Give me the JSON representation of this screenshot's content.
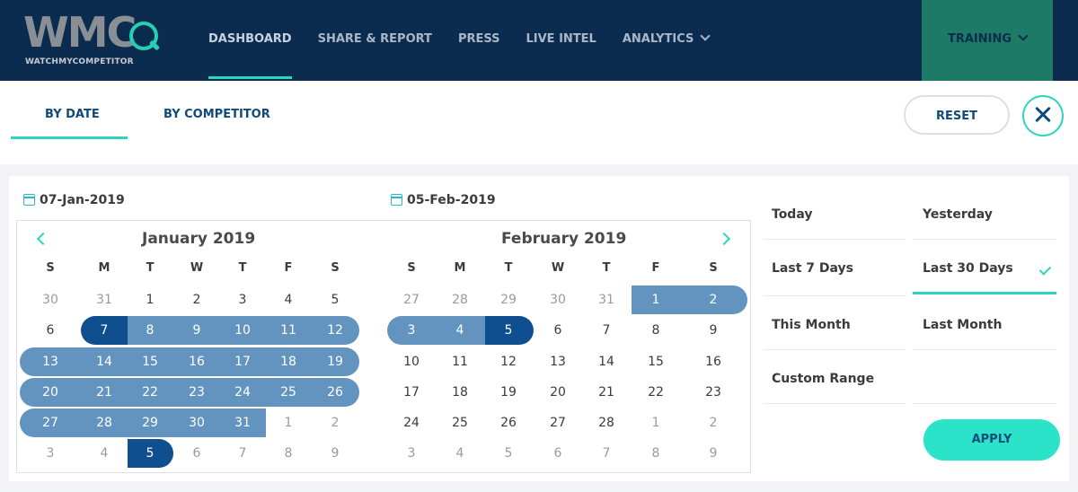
{
  "brand": {
    "logo_text": "WMC",
    "logo_subtitle": "WATCHMYCOMPETITOR",
    "accent": "#2ad6bf",
    "navy": "#0c2c4f"
  },
  "nav": {
    "items": [
      {
        "label": "DASHBOARD",
        "active": true
      },
      {
        "label": "SHARE & REPORT"
      },
      {
        "label": "PRESS"
      },
      {
        "label": "LIVE INTEL"
      },
      {
        "label": "ANALYTICS",
        "dropdown": true
      }
    ],
    "training": "TRAINING"
  },
  "tabs": {
    "by_date": "BY DATE",
    "by_competitor": "BY COMPETITOR",
    "active": "BY DATE"
  },
  "actions": {
    "reset": "RESET",
    "apply": "APPLY",
    "close_icon": "close-icon"
  },
  "range": {
    "start": "07-Jan-2019",
    "end": "05-Feb-2019"
  },
  "calendar": {
    "weekdays": [
      "S",
      "M",
      "T",
      "W",
      "T",
      "F",
      "S"
    ],
    "left": {
      "title": "January 2019",
      "rows": [
        [
          "30",
          "31",
          "1",
          "2",
          "3",
          "4",
          "5"
        ],
        [
          "6",
          "7",
          "8",
          "9",
          "10",
          "11",
          "12"
        ],
        [
          "13",
          "14",
          "15",
          "16",
          "17",
          "18",
          "19"
        ],
        [
          "20",
          "21",
          "22",
          "23",
          "24",
          "25",
          "26"
        ],
        [
          "27",
          "28",
          "29",
          "30",
          "31",
          "1",
          "2"
        ],
        [
          "3",
          "4",
          "5",
          "6",
          "7",
          "8",
          "9"
        ]
      ]
    },
    "right": {
      "title": "February 2019",
      "rows": [
        [
          "27",
          "28",
          "29",
          "30",
          "31",
          "1",
          "2"
        ],
        [
          "3",
          "4",
          "5",
          "6",
          "7",
          "8",
          "9"
        ],
        [
          "10",
          "11",
          "12",
          "13",
          "14",
          "15",
          "16"
        ],
        [
          "17",
          "18",
          "19",
          "20",
          "21",
          "22",
          "23"
        ],
        [
          "24",
          "25",
          "26",
          "27",
          "28",
          "1",
          "2"
        ],
        [
          "3",
          "4",
          "5",
          "6",
          "7",
          "8",
          "9"
        ]
      ]
    }
  },
  "presets": {
    "today": "Today",
    "yesterday": "Yesterday",
    "last7": "Last 7 Days",
    "last30": "Last 30 Days",
    "this_month": "This Month",
    "last_month": "Last Month",
    "custom": "Custom Range",
    "selected": "Last 30 Days"
  }
}
